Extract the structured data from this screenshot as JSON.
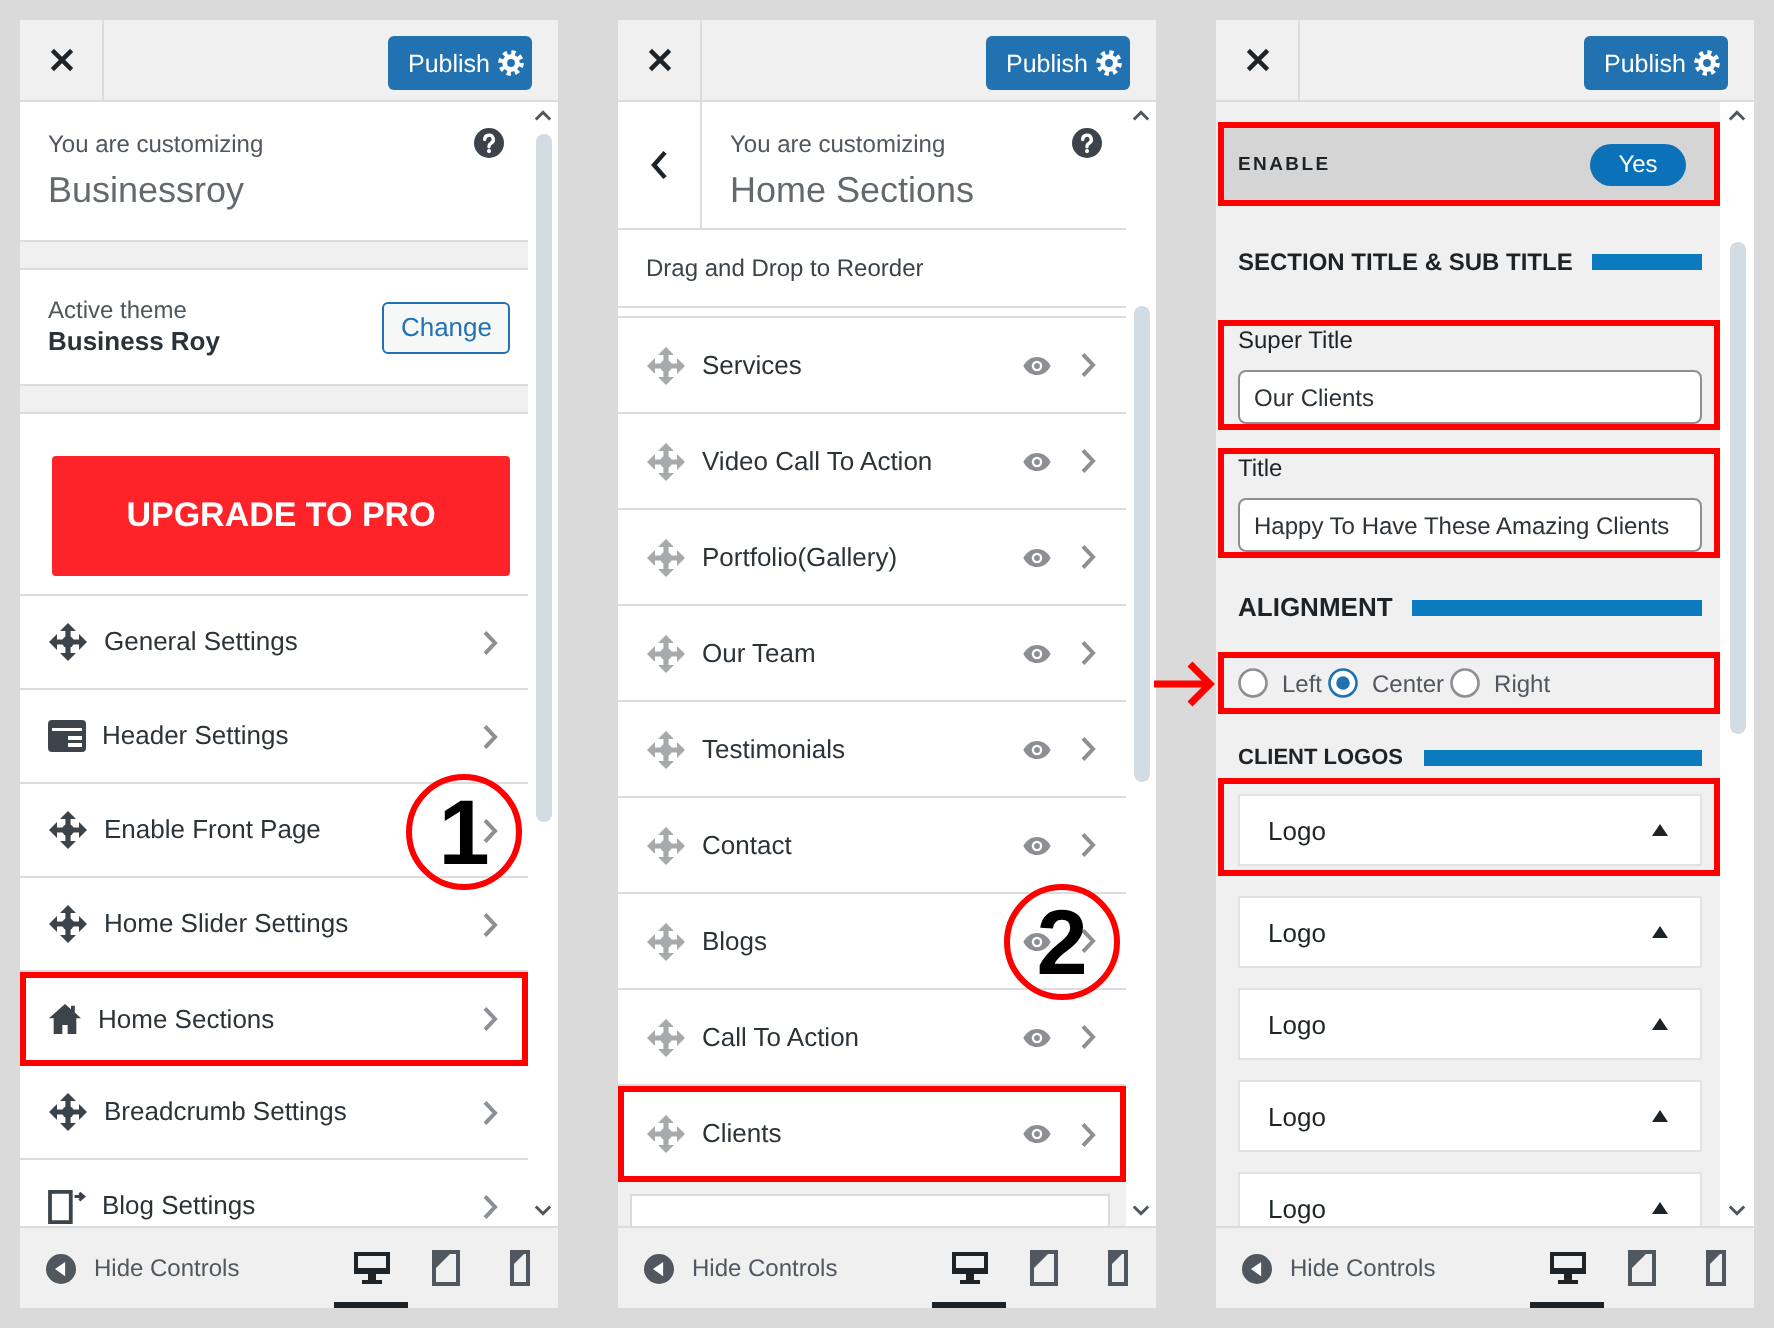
{
  "panels": [
    {
      "header": {
        "publish": "Publish"
      },
      "info": {
        "back_button": false,
        "caption": "You are customizing",
        "title": "Businessroy"
      },
      "theme": {
        "caption": "Active theme",
        "name": "Business Roy",
        "button": "Change"
      },
      "upgrade": "UPGRADE TO PRO",
      "items": [
        {
          "kind": "move",
          "label": "General Settings",
          "highlighted": false
        },
        {
          "kind": "header",
          "label": "Header Settings",
          "highlighted": false
        },
        {
          "kind": "move",
          "label": "Enable Front Page",
          "highlighted": false,
          "callout": "1"
        },
        {
          "kind": "move",
          "label": "Home Slider Settings",
          "highlighted": false
        },
        {
          "kind": "home",
          "label": "Home Sections",
          "highlighted": true
        },
        {
          "kind": "move",
          "label": "Breadcrumb Settings",
          "highlighted": false
        },
        {
          "kind": "blog",
          "label": "Blog Settings",
          "highlighted": false
        }
      ],
      "footer": {
        "label": "Hide Controls",
        "devices": [
          {
            "kind": "desktop",
            "selected": true
          },
          {
            "kind": "tablet",
            "selected": false
          },
          {
            "kind": "mobile",
            "selected": false
          }
        ]
      }
    },
    {
      "header": {
        "publish": "Publish"
      },
      "info": {
        "back_button": true,
        "caption": "You are customizing",
        "title": "Home Sections"
      },
      "note": "Drag and Drop to Reorder",
      "items": [
        {
          "kind": "section",
          "label": "Services",
          "highlighted": false
        },
        {
          "kind": "section",
          "label": "Video Call To Action",
          "highlighted": false
        },
        {
          "kind": "section",
          "label": "Portfolio(Gallery)",
          "highlighted": false
        },
        {
          "kind": "section",
          "label": "Our Team",
          "highlighted": false
        },
        {
          "kind": "section",
          "label": "Testimonials",
          "highlighted": false
        },
        {
          "kind": "section",
          "label": "Contact",
          "highlighted": false
        },
        {
          "kind": "section",
          "label": "Blogs",
          "highlighted": false,
          "callout": "2"
        },
        {
          "kind": "section",
          "label": "Call To Action",
          "highlighted": false
        },
        {
          "kind": "section",
          "label": "Clients",
          "highlighted": true
        }
      ],
      "bottom_card": true,
      "footer": {
        "label": "Hide Controls",
        "devices": [
          {
            "kind": "desktop",
            "selected": true
          },
          {
            "kind": "tablet",
            "selected": false
          },
          {
            "kind": "mobile",
            "selected": false
          }
        ]
      }
    },
    {
      "header": {
        "publish": "Publish"
      },
      "settings": [
        {
          "kind": "toggle",
          "label": "ENABLE",
          "value": "Yes",
          "on": true,
          "highlighted": true
        },
        {
          "kind": "heading",
          "label": "SECTION TITLE & SUB TITLE"
        },
        {
          "kind": "text",
          "label": "Super Title",
          "value": "Our Clients",
          "highlighted": true
        },
        {
          "kind": "text",
          "label": "Title",
          "value": "Happy To Have These Amazing Clients",
          "highlighted": true
        },
        {
          "kind": "heading",
          "label": "ALIGNMENT"
        },
        {
          "kind": "radio",
          "options": [
            {
              "label": "Left",
              "selected": false
            },
            {
              "label": "Center",
              "selected": true
            },
            {
              "label": "Right",
              "selected": false
            }
          ],
          "highlighted": true,
          "arrow": true
        },
        {
          "kind": "heading",
          "label": "CLIENT LOGOS"
        },
        {
          "kind": "logo",
          "label": "Logo",
          "highlighted": true
        },
        {
          "kind": "logo",
          "label": "Logo",
          "highlighted": false
        },
        {
          "kind": "logo",
          "label": "Logo",
          "highlighted": false
        },
        {
          "kind": "logo",
          "label": "Logo",
          "highlighted": false
        },
        {
          "kind": "logo",
          "label": "Logo",
          "highlighted": false
        }
      ],
      "footer": {
        "label": "Hide Controls",
        "devices": [
          {
            "kind": "desktop",
            "selected": true
          },
          {
            "kind": "tablet",
            "selected": false
          },
          {
            "kind": "mobile",
            "selected": false
          }
        ]
      }
    }
  ]
}
